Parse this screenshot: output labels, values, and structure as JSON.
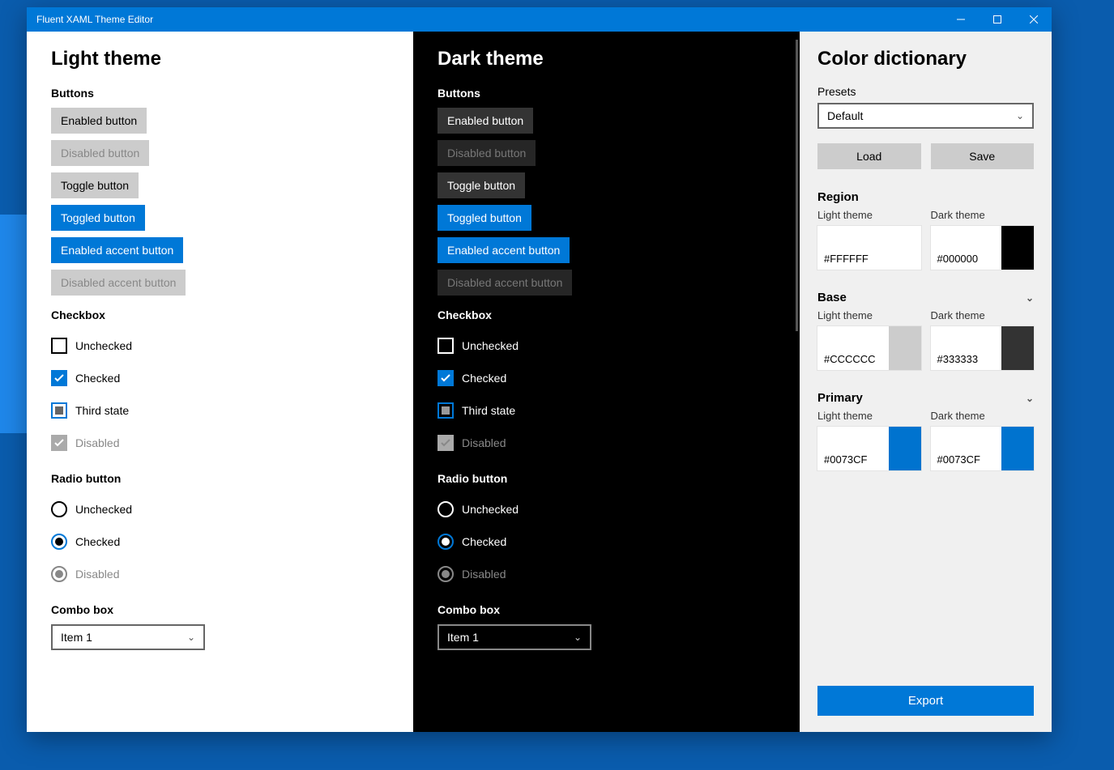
{
  "window": {
    "title": "Fluent XAML Theme Editor"
  },
  "panels": {
    "light": {
      "title": "Light theme"
    },
    "dark": {
      "title": "Dark theme"
    }
  },
  "sections": {
    "buttons": "Buttons",
    "checkbox": "Checkbox",
    "radio": "Radio button",
    "combo": "Combo box"
  },
  "buttons": {
    "enabled": "Enabled button",
    "disabled": "Disabled button",
    "toggle": "Toggle button",
    "toggled": "Toggled button",
    "accent": "Enabled accent button",
    "accent_disabled": "Disabled accent button"
  },
  "checkbox": {
    "unchecked": "Unchecked",
    "checked": "Checked",
    "third": "Third state",
    "disabled": "Disabled"
  },
  "radio": {
    "unchecked": "Unchecked",
    "checked": "Checked",
    "disabled": "Disabled"
  },
  "combo": {
    "selected": "Item 1"
  },
  "side": {
    "title": "Color dictionary",
    "presets_label": "Presets",
    "preset_selected": "Default",
    "load": "Load",
    "save": "Save",
    "light_col": "Light theme",
    "dark_col": "Dark theme",
    "export": "Export",
    "categories": {
      "region": {
        "name": "Region",
        "light": {
          "hex": "#FFFFFF",
          "color": "#FFFFFF"
        },
        "dark": {
          "hex": "#000000",
          "color": "#000000"
        }
      },
      "base": {
        "name": "Base",
        "light": {
          "hex": "#CCCCCC",
          "color": "#CCCCCC"
        },
        "dark": {
          "hex": "#333333",
          "color": "#333333"
        }
      },
      "primary": {
        "name": "Primary",
        "light": {
          "hex": "#0073CF",
          "color": "#0073CF"
        },
        "dark": {
          "hex": "#0073CF",
          "color": "#0073CF"
        }
      }
    }
  }
}
